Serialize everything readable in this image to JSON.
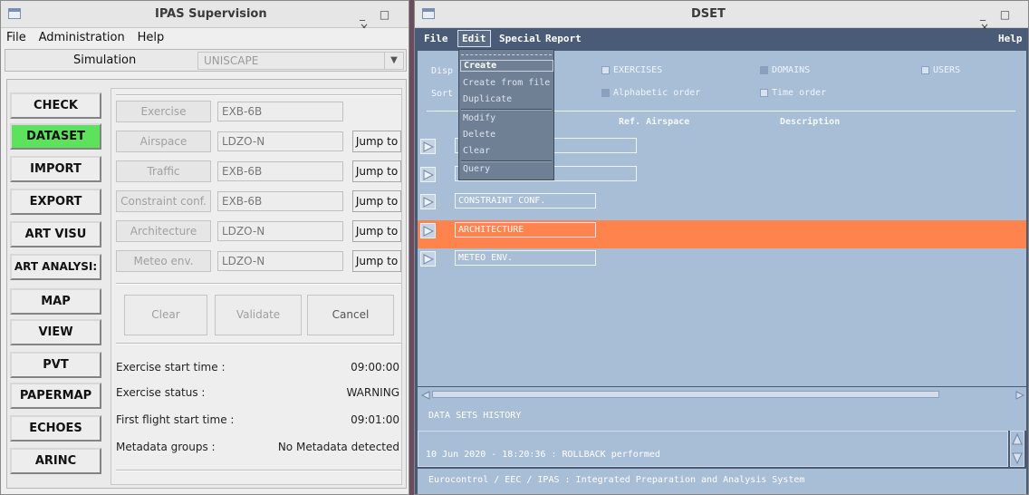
{
  "left_window": {
    "title": "IPAS Supervision",
    "controls": "_ □ ×",
    "menu": [
      "File",
      "Administration",
      "Help"
    ],
    "sim_label": "Simulation",
    "sim_value": "UNISCAPE",
    "sidebar": [
      "CHECK",
      "DATASET",
      "IMPORT",
      "EXPORT",
      "ART VISU",
      "ART ANALYSI:",
      "MAP",
      "VIEW",
      "PVT",
      "PAPERMAP",
      "ECHOES",
      "ARINC"
    ],
    "fields": [
      {
        "label": "Exercise",
        "value": "EXB-6B",
        "jump": ""
      },
      {
        "label": "Airspace",
        "value": "LDZO-N",
        "jump": "Jump to"
      },
      {
        "label": "Traffic",
        "value": "EXB-6B",
        "jump": "Jump to"
      },
      {
        "label": "Constraint conf.",
        "value": "EXB-6B",
        "jump": "Jump to"
      },
      {
        "label": "Architecture",
        "value": "LDZO-N",
        "jump": "Jump to"
      },
      {
        "label": "Meteo env.",
        "value": "LDZO-N",
        "jump": "Jump to"
      }
    ],
    "actions": {
      "clear": "Clear",
      "validate": "Validate",
      "cancel": "Cancel"
    },
    "info": [
      {
        "label": "Exercise start time :",
        "value": "09:00:00"
      },
      {
        "label": "Exercise status :",
        "value": "WARNING"
      },
      {
        "label": "First flight start time :",
        "value": "09:01:00"
      },
      {
        "label": "Metadata groups :",
        "value": "No Metadata detected"
      }
    ]
  },
  "right_window": {
    "title": "DSET",
    "controls": "_ □ ×",
    "menu": {
      "file": "File",
      "edit": "Edit",
      "special": "Special",
      "report": "Report",
      "help": "Help"
    },
    "display_label": "Disp",
    "sort_label": "Sort",
    "checks": {
      "exercises": "EXERCISES",
      "domains": "DOMAINS",
      "users": "USERS",
      "alpha": "Alphabetic order",
      "time": "Time order"
    },
    "headers": {
      "ref_airspace": "Ref. Airspace",
      "description": "Description"
    },
    "rows": [
      "",
      "",
      "CONSTRAINT CONF.",
      "ARCHITECTURE",
      "METEO ENV."
    ],
    "edit_menu": [
      "Create",
      "Create from file",
      "Duplicate",
      "Modify",
      "Delete",
      "Clear",
      "Query"
    ],
    "history_label": "DATA SETS HISTORY",
    "history_line": "10 Jun 2020 - 18:20:36 : ROLLBACK performed",
    "footer": "Eurocontrol / EEC / IPAS : Integrated Preparation and Analysis System"
  },
  "colors": {
    "active_green": "#5ee25e",
    "highlight_orange": "#ff834c",
    "panel_blue": "#a8bdd6",
    "menubar_blue": "#495b76"
  }
}
